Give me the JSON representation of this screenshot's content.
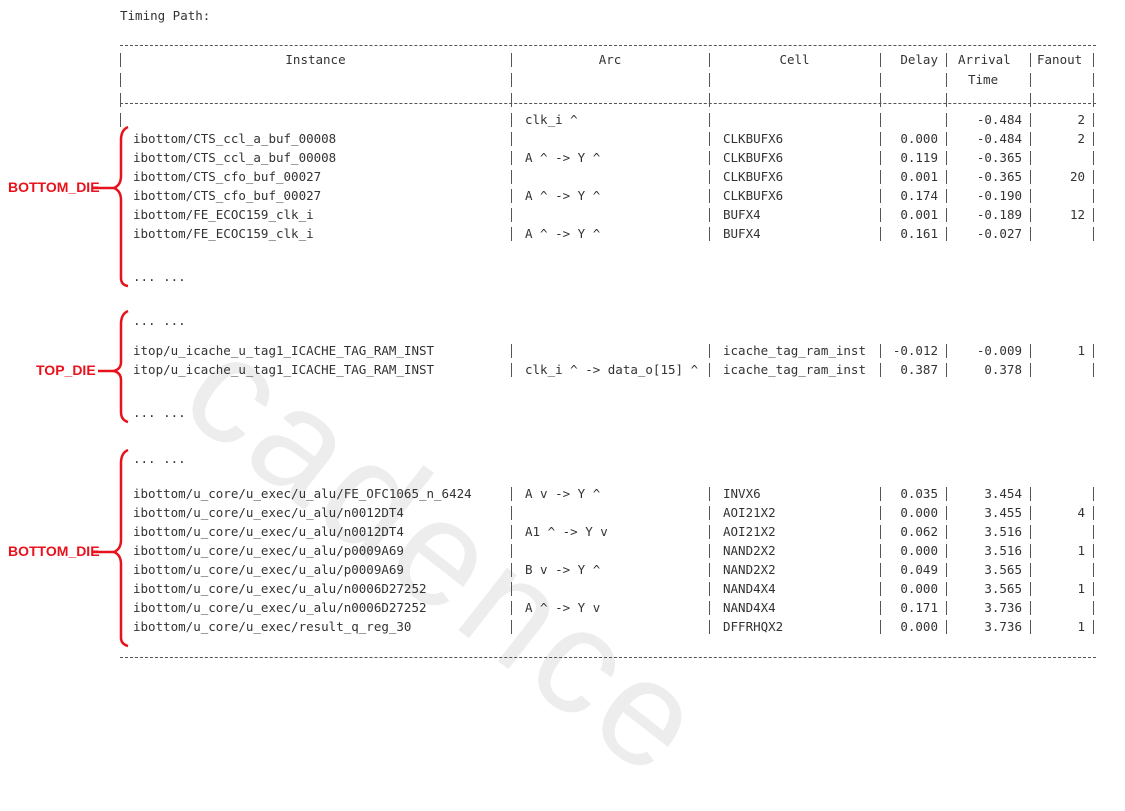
{
  "title": "Timing Path:",
  "watermark": "cadence",
  "accent_color": "#e8121c",
  "headers": {
    "instance": "Instance",
    "arc": "Arc",
    "cell": "Cell",
    "delay": "Delay",
    "arrival_1": "Arrival",
    "arrival_2": "Time",
    "fanout": "Fanout"
  },
  "ellipsis": "... ...",
  "groups": [
    {
      "label": "BOTTOM_DIE"
    },
    {
      "label": "TOP_DIE"
    },
    {
      "label": "BOTTOM_DIE"
    }
  ],
  "rows": [
    {
      "instance": "",
      "arc": "clk_i ^",
      "cell": "",
      "delay": "",
      "arrival": "-0.484",
      "fanout": "2"
    },
    {
      "instance": "ibottom/CTS_ccl_a_buf_00008",
      "arc": "",
      "cell": "CLKBUFX6",
      "delay": "0.000",
      "arrival": "-0.484",
      "fanout": "2"
    },
    {
      "instance": "ibottom/CTS_ccl_a_buf_00008",
      "arc": "A ^ -> Y ^",
      "cell": "CLKBUFX6",
      "delay": "0.119",
      "arrival": "-0.365",
      "fanout": ""
    },
    {
      "instance": "ibottom/CTS_cfo_buf_00027",
      "arc": "",
      "cell": "CLKBUFX6",
      "delay": "0.001",
      "arrival": "-0.365",
      "fanout": "20"
    },
    {
      "instance": "ibottom/CTS_cfo_buf_00027",
      "arc": "A ^ -> Y ^",
      "cell": "CLKBUFX6",
      "delay": "0.174",
      "arrival": "-0.190",
      "fanout": ""
    },
    {
      "instance": "ibottom/FE_ECOC159_clk_i",
      "arc": "",
      "cell": "BUFX4",
      "delay": "0.001",
      "arrival": "-0.189",
      "fanout": "12"
    },
    {
      "instance": "ibottom/FE_ECOC159_clk_i",
      "arc": "A ^ -> Y ^",
      "cell": "BUFX4",
      "delay": "0.161",
      "arrival": "-0.027",
      "fanout": ""
    },
    {
      "instance": "itop/u_icache_u_tag1_ICACHE_TAG_RAM_INST",
      "arc": "",
      "cell": "icache_tag_ram_inst",
      "delay": "-0.012",
      "arrival": "-0.009",
      "fanout": "1"
    },
    {
      "instance": "itop/u_icache_u_tag1_ICACHE_TAG_RAM_INST",
      "arc": "clk_i ^ -> data_o[15] ^",
      "cell": "icache_tag_ram_inst",
      "delay": "0.387",
      "arrival": "0.378",
      "fanout": ""
    },
    {
      "instance": "ibottom/u_core/u_exec/u_alu/FE_OFC1065_n_6424",
      "arc": "A v -> Y ^",
      "cell": "INVX6",
      "delay": "0.035",
      "arrival": "3.454",
      "fanout": ""
    },
    {
      "instance": "ibottom/u_core/u_exec/u_alu/n0012DT4",
      "arc": "",
      "cell": "AOI21X2",
      "delay": "0.000",
      "arrival": "3.455",
      "fanout": "4"
    },
    {
      "instance": "ibottom/u_core/u_exec/u_alu/n0012DT4",
      "arc": "A1 ^ -> Y v",
      "cell": "AOI21X2",
      "delay": "0.062",
      "arrival": "3.516",
      "fanout": ""
    },
    {
      "instance": "ibottom/u_core/u_exec/u_alu/p0009A69",
      "arc": "",
      "cell": "NAND2X2",
      "delay": "0.000",
      "arrival": "3.516",
      "fanout": "1"
    },
    {
      "instance": "ibottom/u_core/u_exec/u_alu/p0009A69",
      "arc": "B v -> Y ^",
      "cell": "NAND2X2",
      "delay": "0.049",
      "arrival": "3.565",
      "fanout": ""
    },
    {
      "instance": "ibottom/u_core/u_exec/u_alu/n0006D27252",
      "arc": "",
      "cell": "NAND4X4",
      "delay": "0.000",
      "arrival": "3.565",
      "fanout": "1"
    },
    {
      "instance": "ibottom/u_core/u_exec/u_alu/n0006D27252",
      "arc": "A ^ -> Y v",
      "cell": "NAND4X4",
      "delay": "0.171",
      "arrival": "3.736",
      "fanout": ""
    },
    {
      "instance": "ibottom/u_core/u_exec/result_q_reg_30",
      "arc": "",
      "cell": "DFFRHQX2",
      "delay": "0.000",
      "arrival": "3.736",
      "fanout": "1"
    }
  ]
}
